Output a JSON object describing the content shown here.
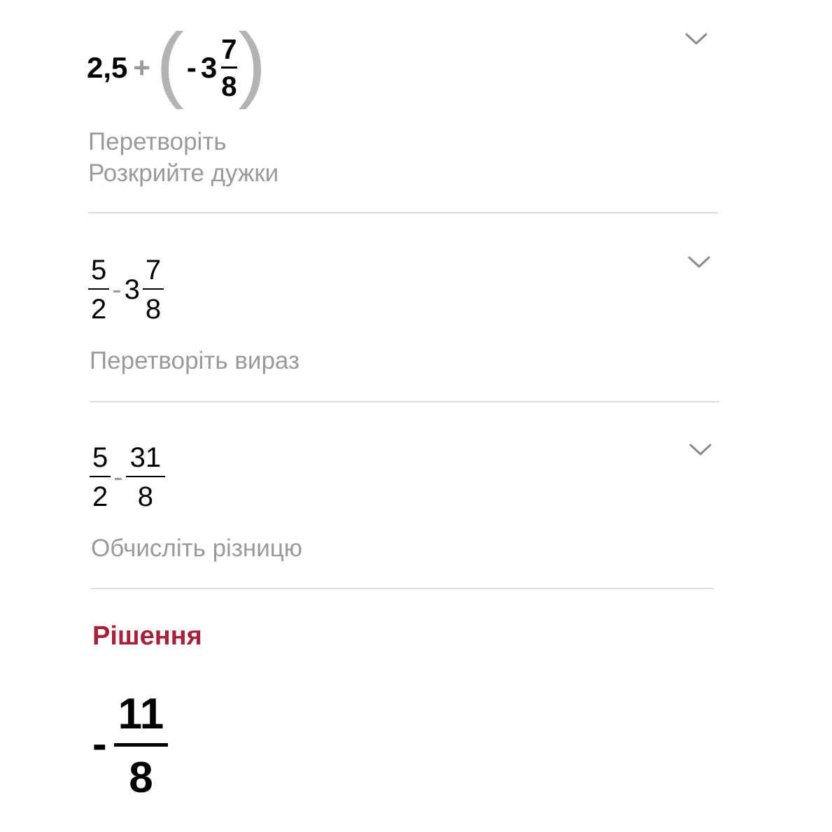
{
  "steps": [
    {
      "expression": {
        "whole": "2,5",
        "op": "+",
        "sign": "-",
        "mixed_whole": "3",
        "num": "7",
        "den": "8"
      },
      "descriptions": [
        "Перетворіть",
        "Розкрийте дужки"
      ]
    },
    {
      "expression": {
        "num1": "5",
        "den1": "2",
        "op": "-",
        "mixed_whole": "3",
        "num2": "7",
        "den2": "8"
      },
      "descriptions": [
        "Перетворіть вираз"
      ]
    },
    {
      "expression": {
        "num1": "5",
        "den1": "2",
        "op": "-",
        "num2": "31",
        "den2": "8"
      },
      "descriptions": [
        "Обчисліть різницю"
      ]
    }
  ],
  "solution": {
    "title": "Рішення",
    "sign": "-",
    "num": "11",
    "den": "8"
  },
  "icons": {
    "expand": "chevron-down-icon"
  },
  "colors": {
    "accent": "#a8213a",
    "muted_text": "#9a9a9a",
    "divider": "#dcdcdc"
  }
}
